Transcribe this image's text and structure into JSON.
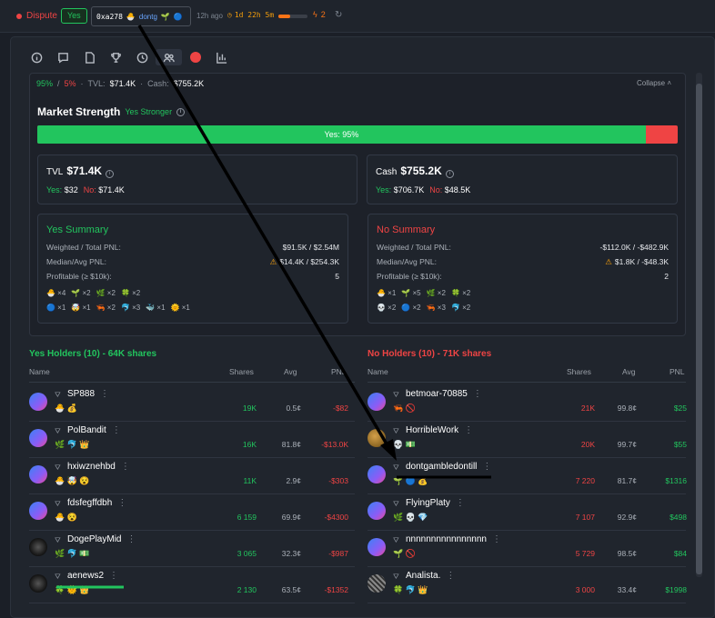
{
  "topbar": {
    "status": "Dispute",
    "outcome": "Yes",
    "address": "0xa278",
    "address_name": "dontg",
    "ago": "12h ago",
    "timer": "1d 22h 5m",
    "timer_progress": 0.4,
    "bolt_count": "2"
  },
  "tabs": [
    "info-icon",
    "chat-icon",
    "document-icon",
    "trophy-icon",
    "history-icon",
    "holders-icon",
    "live-icon",
    "chart-icon"
  ],
  "summary": {
    "yes_pct": "95%",
    "no_pct": "5%",
    "tvl_label": "TVL:",
    "tvl": "$71.4K",
    "cash_label": "Cash:",
    "cash": "$755.2K",
    "collapse": "Collapse"
  },
  "strength": {
    "title": "Market Strength",
    "verdict": "Yes Stronger",
    "bar_label": "Yes: 95%",
    "yes_fraction": 0.95
  },
  "tvl_card": {
    "label": "TVL",
    "value": "$71.4K",
    "yes": "Yes:",
    "yes_val": "$32",
    "no": "No:",
    "no_val": "$71.4K"
  },
  "cash_card": {
    "label": "Cash",
    "value": "$755.2K",
    "yes": "Yes:",
    "yes_val": "$706.7K",
    "no": "No:",
    "no_val": "$48.5K"
  },
  "yes_summary": {
    "title": "Yes Summary",
    "rows": [
      {
        "label": "Weighted / Total PNL:",
        "value": "$91.5K / $2.54M"
      },
      {
        "label": "Median/Avg PNL:",
        "value": "$14.4K / $254.3K"
      },
      {
        "label": "Profitable (≥ $10k):",
        "value": "5"
      }
    ],
    "badges1": [
      "🐣 ×4",
      "🌱 ×2",
      "🌿 ×2",
      "🍀 ×2"
    ],
    "badges2": [
      "🔵 ×1",
      "🤯 ×1",
      "🦐 ×2",
      "🐬 ×3",
      "🐳 ×1",
      "🌞 ×1"
    ]
  },
  "no_summary": {
    "title": "No Summary",
    "rows": [
      {
        "label": "Weighted / Total PNL:",
        "value": "-$112.0K / -$482.9K"
      },
      {
        "label": "Median/Avg PNL:",
        "value": "$1.8K / -$48.3K"
      },
      {
        "label": "Profitable (≥ $10k):",
        "value": "2"
      }
    ],
    "badges1": [
      "🐣 ×1",
      "🌱 ×5",
      "🌿 ×2",
      "🍀 ×2"
    ],
    "badges2": [
      "💀 ×2",
      "🔵 ×2",
      "🦐 ×3",
      "🐬 ×2"
    ]
  },
  "yes_holders": {
    "title": "Yes Holders (10) - 64K shares",
    "cols": [
      "Name",
      "Shares",
      "Avg",
      "PNL"
    ],
    "rows": [
      {
        "name": "SP888",
        "badges": "🐣 💰",
        "shares": "19K",
        "avg": "0.5¢",
        "pnl": "-$82"
      },
      {
        "name": "PolBandit",
        "badges": "🌿 🐬 👑",
        "shares": "16K",
        "avg": "81.8¢",
        "pnl": "-$13.0K"
      },
      {
        "name": "hxiwznehbd",
        "badges": "🐣 🤯 😵",
        "shares": "11K",
        "avg": "2.9¢",
        "pnl": "-$303"
      },
      {
        "name": "fdsfegffdbh",
        "badges": "🐣 😵",
        "shares": "6 159",
        "avg": "69.9¢",
        "pnl": "-$4300"
      },
      {
        "name": "DogePlayMid",
        "badges": "🌿 🐬 💵",
        "shares": "3 065",
        "avg": "32.3¢",
        "pnl": "-$987"
      },
      {
        "name": "aenews2",
        "badges": "🍀 🌞 👑",
        "shares": "2 130",
        "avg": "63.5¢",
        "pnl": "-$1352"
      }
    ]
  },
  "no_holders": {
    "title": "No Holders (10) - 71K shares",
    "cols": [
      "Name",
      "Shares",
      "Avg",
      "PNL"
    ],
    "rows": [
      {
        "name": "betmoar-70885",
        "badges": "🦐 🚫",
        "shares": "21K",
        "avg": "99.8¢",
        "pnl": "$25"
      },
      {
        "name": "HorribleWork",
        "badges": "💀 💵",
        "shares": "20K",
        "avg": "99.7¢",
        "pnl": "$55"
      },
      {
        "name": "dontgambledontill",
        "badges": "🌱 🔵 💰",
        "shares": "7 220",
        "avg": "81.7¢",
        "pnl": "$1316"
      },
      {
        "name": "FlyingPlaty",
        "badges": "🌿 💀 💎",
        "shares": "7 107",
        "avg": "92.9¢",
        "pnl": "$498"
      },
      {
        "name": "nnnnnnnnnnnnnnnn",
        "badges": "🌱 🚫",
        "shares": "5 729",
        "avg": "98.5¢",
        "pnl": "$84"
      },
      {
        "name": "Analista.",
        "badges": "🍀 🐬 👑",
        "shares": "3 000",
        "avg": "33.4¢",
        "pnl": "$1998"
      }
    ]
  }
}
